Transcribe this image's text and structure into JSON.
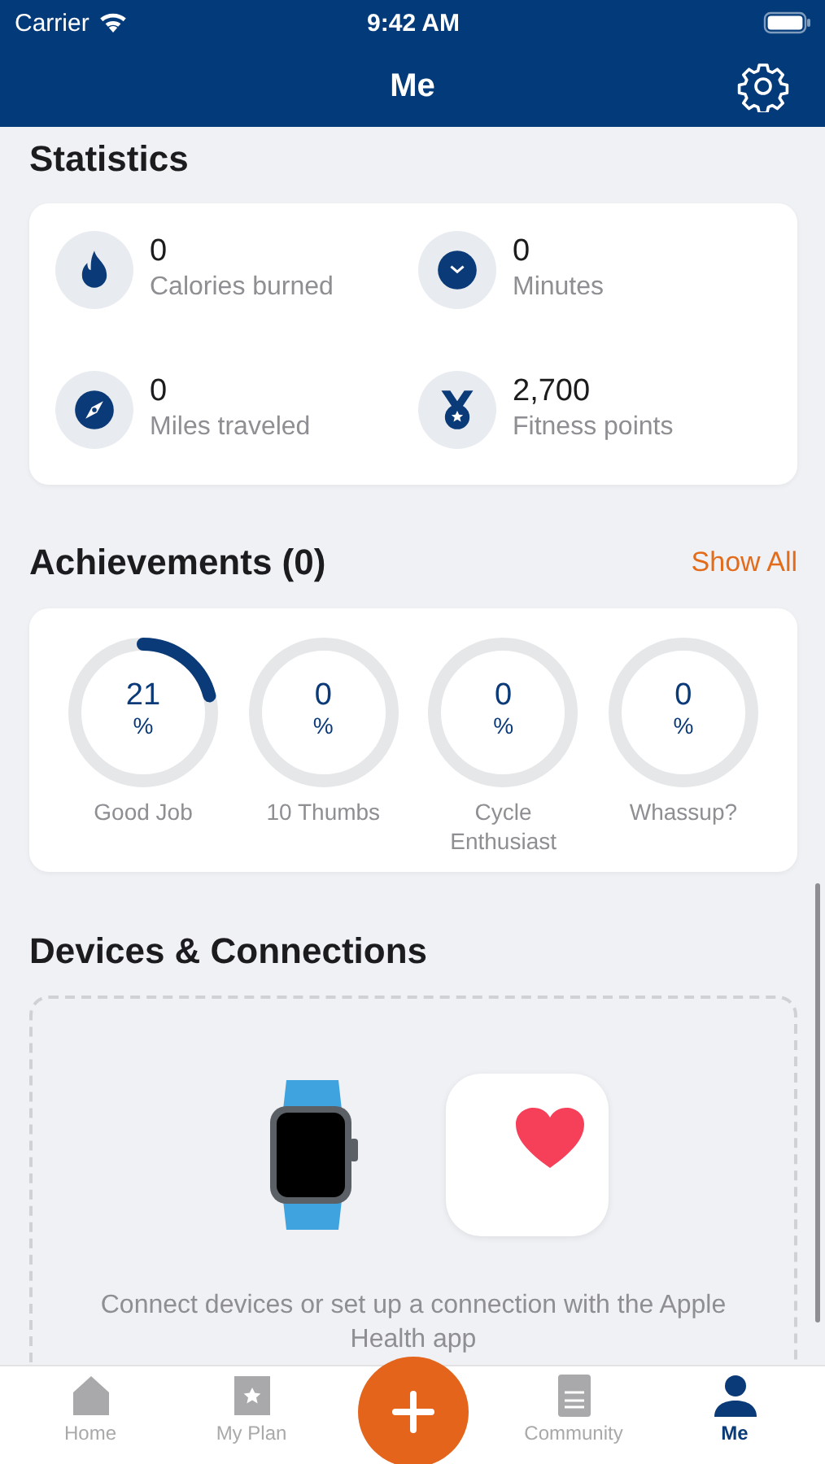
{
  "status_bar": {
    "carrier": "Carrier",
    "time": "9:42 AM"
  },
  "nav": {
    "title": "Me"
  },
  "statistics": {
    "title": "Statistics",
    "items": [
      {
        "kind": "flame",
        "value": "0",
        "label": "Calories burned"
      },
      {
        "kind": "clock",
        "value": "0",
        "label": "Minutes"
      },
      {
        "kind": "compass",
        "value": "0",
        "label": "Miles traveled"
      },
      {
        "kind": "medal",
        "value": "2,700",
        "label": "Fitness points"
      }
    ]
  },
  "achievements": {
    "title": "Achievements (0)",
    "action": "Show All",
    "items": [
      {
        "value": "21",
        "unit": "%",
        "label": "Good Job"
      },
      {
        "value": "0",
        "unit": "%",
        "label": "10 Thumbs"
      },
      {
        "value": "0",
        "unit": "%",
        "label": "Cycle Enthusiast"
      },
      {
        "value": "0",
        "unit": "%",
        "label": "Whassup?"
      }
    ]
  },
  "devices": {
    "title": "Devices & Connections",
    "text": "Connect devices or set up a connection with the Apple Health app"
  },
  "tab_bar": [
    {
      "kind": "home",
      "label": "Home",
      "selected": false
    },
    {
      "kind": "plan",
      "label": "My Plan",
      "selected": false
    },
    {
      "kind": "add",
      "selected": false
    },
    {
      "kind": "community",
      "label": "Community",
      "selected": false
    },
    {
      "kind": "me",
      "label": "Me",
      "selected": true
    }
  ]
}
